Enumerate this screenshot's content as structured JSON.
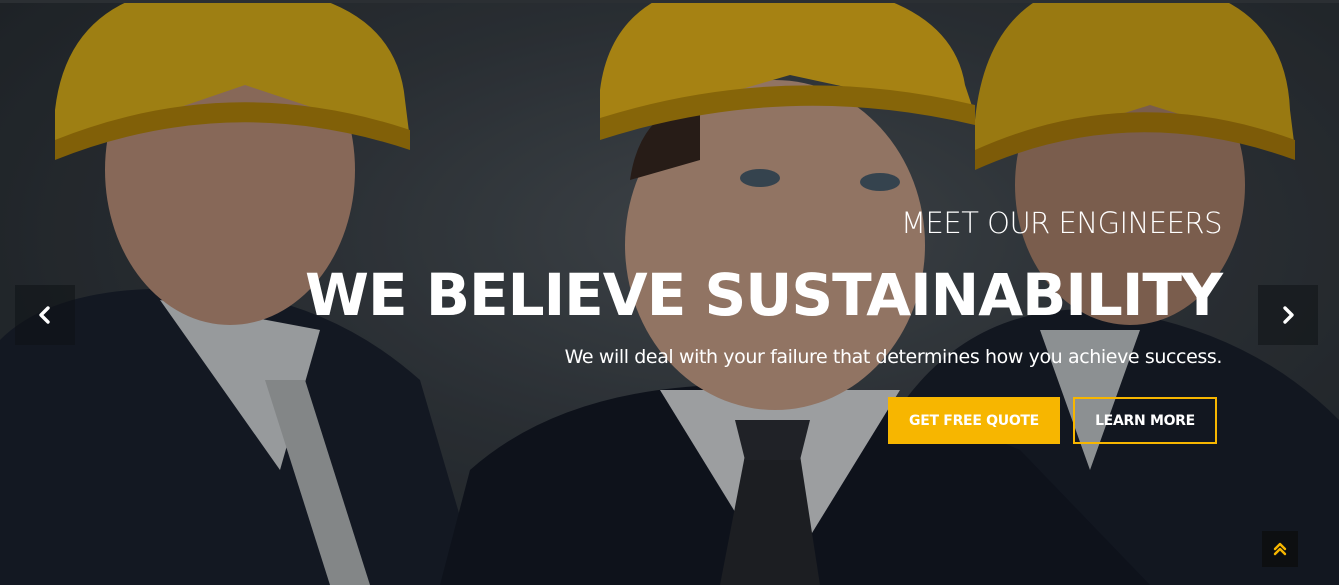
{
  "slider": {
    "subtitle": "MEET OUR ENGINEERS",
    "title": "WE BELIEVE SUSTAINABILITY",
    "description": "We will deal with your failure that determines how you achieve success.",
    "primary_button": "GET FREE QUOTE",
    "secondary_button": "LEARN MORE",
    "prev_icon": "chevron-left-icon",
    "next_icon": "chevron-right-icon",
    "background": "three engineers in yellow hard hats and dark suits"
  },
  "scroll_top": {
    "icon": "double-chevron-up-icon"
  },
  "colors": {
    "accent": "#f7b600",
    "text": "#ffffff",
    "control_bg": "#0d0f11"
  }
}
